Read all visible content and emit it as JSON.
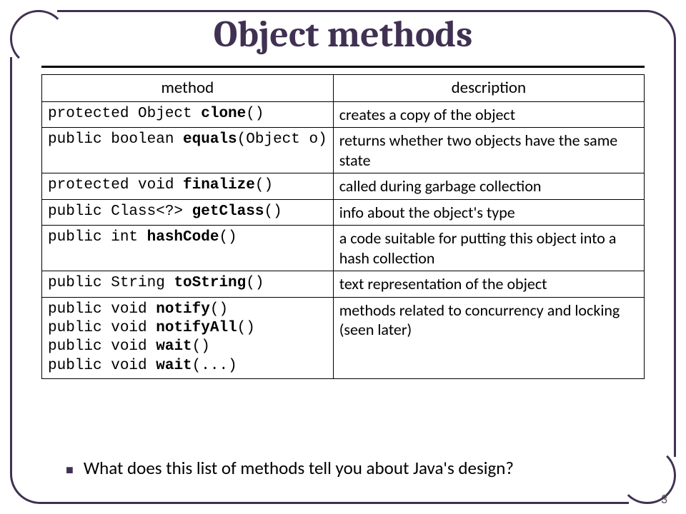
{
  "title": "Object methods",
  "headers": {
    "method": "method",
    "description": "description"
  },
  "rows": [
    {
      "sig": "protected Object <b>clone</b>()",
      "desc": "creates a copy of the object"
    },
    {
      "sig": "public boolean <b>equals</b>(Object o)",
      "desc": "returns whether two objects have the same state"
    },
    {
      "sig": "protected void <b>finalize</b>()",
      "desc": "called during garbage collection"
    },
    {
      "sig": "public Class<?> <b>getClass</b>()",
      "desc": "info about the object's type"
    },
    {
      "sig": "public int <b>hashCode</b>()",
      "desc": "a code suitable for putting this object into a hash collection"
    },
    {
      "sig": "public String <b>toString</b>()",
      "desc": "text representation of the object"
    },
    {
      "sig": "public void <b>notify</b>()\npublic void <b>notifyAll</b>()\npublic void <b>wait</b>()\npublic void <b>wait</b>(...)",
      "desc": "methods related to concurrency and locking  (seen later)"
    }
  ],
  "bullet": "What does this list of methods tell you about Java's design?",
  "page": "3"
}
